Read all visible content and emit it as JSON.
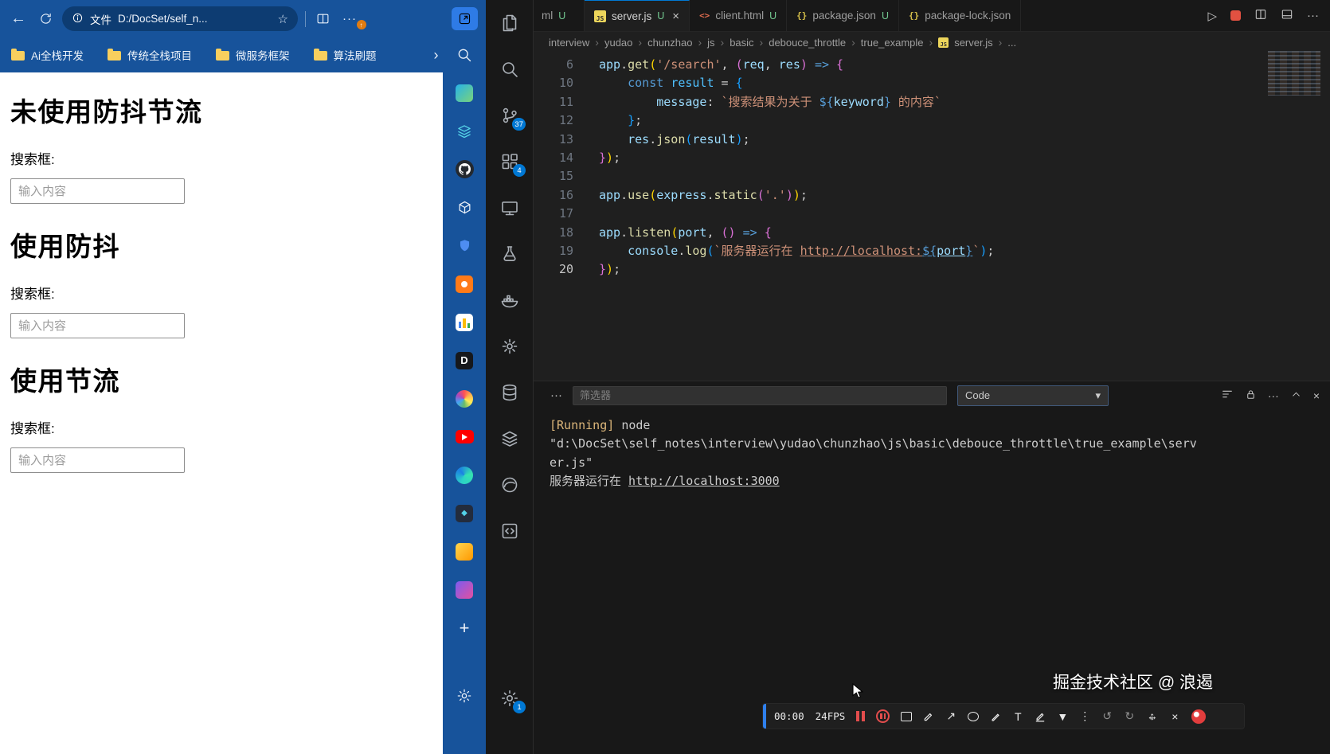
{
  "browser": {
    "toolbar": {
      "file_label": "文件",
      "address": "D:/DocSet/self_n..."
    },
    "bookmarks": [
      "Ai全栈开发",
      "传统全栈项目",
      "微服务框架",
      "算法刷题"
    ],
    "page": {
      "sections": [
        {
          "heading": "未使用防抖节流",
          "label": "搜索框:",
          "placeholder": "输入内容"
        },
        {
          "heading": "使用防抖",
          "label": "搜索框:",
          "placeholder": "输入内容"
        },
        {
          "heading": "使用节流",
          "label": "搜索框:",
          "placeholder": "输入内容"
        }
      ]
    }
  },
  "vscode": {
    "activity": {
      "scm_badge": "37",
      "ext_badge": "4",
      "settings_badge": "1"
    },
    "tabs": [
      {
        "label": "ml",
        "dirty": "U"
      },
      {
        "label": "server.js",
        "dirty": "U"
      },
      {
        "label": "client.html",
        "dirty": "U"
      },
      {
        "label": "package.json",
        "dirty": "U"
      },
      {
        "label": "package-lock.json",
        "dirty": ""
      }
    ],
    "breadcrumb": {
      "items": [
        "interview",
        "yudao",
        "chunzhao",
        "js",
        "basic",
        "debouce_throttle",
        "true_example"
      ],
      "file": "server.js",
      "tail": "..."
    },
    "editor": {
      "lines": [
        {
          "num": "6",
          "tokens": [
            {
              "t": "app",
              "c": "v"
            },
            {
              "t": ".",
              "c": "p"
            },
            {
              "t": "get",
              "c": "f"
            },
            {
              "t": "(",
              "c": "b1"
            },
            {
              "t": "'/search'",
              "c": "s"
            },
            {
              "t": ", ",
              "c": "p"
            },
            {
              "t": "(",
              "c": "b2"
            },
            {
              "t": "req",
              "c": "v"
            },
            {
              "t": ", ",
              "c": "p"
            },
            {
              "t": "res",
              "c": "v"
            },
            {
              "t": ")",
              "c": "b2"
            },
            {
              "t": " ",
              "c": "p"
            },
            {
              "t": "=>",
              "c": "k"
            },
            {
              "t": " ",
              "c": "p"
            },
            {
              "t": "{",
              "c": "b2"
            }
          ]
        },
        {
          "num": "10",
          "tokens": [
            {
              "t": "    ",
              "c": "p"
            },
            {
              "t": "const",
              "c": "k"
            },
            {
              "t": " ",
              "c": "p"
            },
            {
              "t": "result",
              "c": "cv"
            },
            {
              "t": " = ",
              "c": "p"
            },
            {
              "t": "{",
              "c": "b3"
            }
          ]
        },
        {
          "num": "11",
          "tokens": [
            {
              "t": "        ",
              "c": "p"
            },
            {
              "t": "message",
              "c": "v"
            },
            {
              "t": ": ",
              "c": "p"
            },
            {
              "t": "`搜索结果为关于 ",
              "c": "s"
            },
            {
              "t": "${",
              "c": "k"
            },
            {
              "t": "keyword",
              "c": "v"
            },
            {
              "t": "}",
              "c": "k"
            },
            {
              "t": " 的内容`",
              "c": "s"
            }
          ]
        },
        {
          "num": "12",
          "tokens": [
            {
              "t": "    ",
              "c": "p"
            },
            {
              "t": "}",
              "c": "b3"
            },
            {
              "t": ";",
              "c": "p"
            }
          ]
        },
        {
          "num": "13",
          "tokens": [
            {
              "t": "    ",
              "c": "p"
            },
            {
              "t": "res",
              "c": "v"
            },
            {
              "t": ".",
              "c": "p"
            },
            {
              "t": "json",
              "c": "f"
            },
            {
              "t": "(",
              "c": "b3"
            },
            {
              "t": "result",
              "c": "v"
            },
            {
              "t": ")",
              "c": "b3"
            },
            {
              "t": ";",
              "c": "p"
            }
          ]
        },
        {
          "num": "14",
          "tokens": [
            {
              "t": "}",
              "c": "b2"
            },
            {
              "t": ")",
              "c": "b1"
            },
            {
              "t": ";",
              "c": "p"
            }
          ]
        },
        {
          "num": "15",
          "tokens": []
        },
        {
          "num": "16",
          "tokens": [
            {
              "t": "app",
              "c": "v"
            },
            {
              "t": ".",
              "c": "p"
            },
            {
              "t": "use",
              "c": "f"
            },
            {
              "t": "(",
              "c": "b1"
            },
            {
              "t": "express",
              "c": "v"
            },
            {
              "t": ".",
              "c": "p"
            },
            {
              "t": "static",
              "c": "f"
            },
            {
              "t": "(",
              "c": "b2"
            },
            {
              "t": "'.'",
              "c": "s"
            },
            {
              "t": ")",
              "c": "b2"
            },
            {
              "t": ")",
              "c": "b1"
            },
            {
              "t": ";",
              "c": "p"
            }
          ]
        },
        {
          "num": "17",
          "tokens": []
        },
        {
          "num": "18",
          "tokens": [
            {
              "t": "app",
              "c": "v"
            },
            {
              "t": ".",
              "c": "p"
            },
            {
              "t": "listen",
              "c": "f"
            },
            {
              "t": "(",
              "c": "b1"
            },
            {
              "t": "port",
              "c": "v"
            },
            {
              "t": ", ",
              "c": "p"
            },
            {
              "t": "()",
              "c": "b2"
            },
            {
              "t": " ",
              "c": "p"
            },
            {
              "t": "=>",
              "c": "k"
            },
            {
              "t": " ",
              "c": "p"
            },
            {
              "t": "{",
              "c": "b2"
            }
          ]
        },
        {
          "num": "19",
          "tokens": [
            {
              "t": "    ",
              "c": "p"
            },
            {
              "t": "console",
              "c": "v"
            },
            {
              "t": ".",
              "c": "p"
            },
            {
              "t": "log",
              "c": "f"
            },
            {
              "t": "(",
              "c": "b3"
            },
            {
              "t": "`服务器运行在 ",
              "c": "s"
            },
            {
              "t": "http://localhost:",
              "c": "s",
              "u": true
            },
            {
              "t": "${",
              "c": "k",
              "u": true
            },
            {
              "t": "port",
              "c": "v",
              "u": true
            },
            {
              "t": "}",
              "c": "k",
              "u": true
            },
            {
              "t": "`",
              "c": "s"
            },
            {
              "t": ")",
              "c": "b3"
            },
            {
              "t": ";",
              "c": "p"
            }
          ]
        },
        {
          "num": "20",
          "tokens": [
            {
              "t": "}",
              "c": "b2"
            },
            {
              "t": ")",
              "c": "b1"
            },
            {
              "t": ";",
              "c": "p"
            }
          ]
        }
      ]
    },
    "panel": {
      "filter_placeholder": "筛选器",
      "channel": "Code",
      "output": [
        {
          "tokens": [
            {
              "t": "[Running] ",
              "c": "run"
            },
            {
              "t": "node",
              "c": "out"
            }
          ]
        },
        {
          "tokens": [
            {
              "t": "\"d:\\DocSet\\self_notes\\interview\\yudao\\chunzhao\\js\\basic\\debouce_throttle\\true_example\\serv",
              "c": "out"
            }
          ]
        },
        {
          "tokens": [
            {
              "t": "er.js\"",
              "c": "out"
            }
          ]
        },
        {
          "tokens": [
            {
              "t": "服务器运行在 ",
              "c": "out"
            },
            {
              "t": "http://localhost:3000",
              "c": "out",
              "u": true
            }
          ]
        }
      ]
    }
  },
  "recorder": {
    "time": "00:00",
    "fps": "24FPS",
    "watermark": "掘金技术社区 @ 浪遏"
  },
  "colors": {
    "accent": "#0078d4",
    "edge_blue": "#17539b",
    "badge_orange": "#e07c12",
    "dirty_green": "#73c991"
  },
  "glyphs": {
    "back": "←",
    "star": "☆",
    "more_h": "···",
    "more_v": "⋮",
    "chev_r": "›",
    "chev_d": "▾",
    "plus": "+",
    "close": "×",
    "play": "▷",
    "arrow_ne": "↗",
    "text_tool": "T",
    "funnel": "▼",
    "undo": "↺",
    "redo": "↻",
    "arrow_h": "↔",
    "arrow_v": "↕",
    "arrow_up": "↑",
    "js_icon": "JS",
    "html_icon": "<>",
    "json_icon": "{}",
    "d_app": "D",
    "diamond": "◆"
  }
}
